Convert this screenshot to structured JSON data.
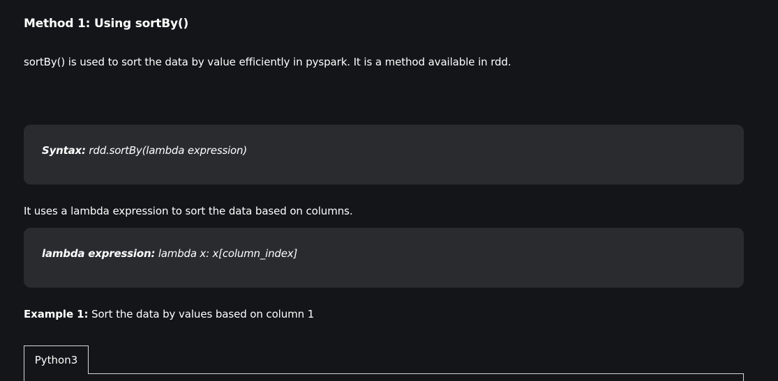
{
  "heading": "Method 1: Using sortBy()",
  "intro": "sortBy() is used to sort the data by value efficiently in pyspark. It is a method available in rdd.",
  "syntax": {
    "label": "Syntax:",
    "code": "rdd.sortBy(lambda expression)"
  },
  "uses_text": "It uses a lambda expression to sort the data based on columns.",
  "lambda": {
    "label": "lambda expression:",
    "code": "lambda x: x[column_index]"
  },
  "example": {
    "label": "Example 1:",
    "text": "Sort the data by values based on column 1"
  },
  "tabs": [
    {
      "label": "Python3",
      "active": true
    }
  ],
  "colors": {
    "background": "#141518",
    "code_box": "#2a2b2f",
    "text": "#ffffff",
    "tab_border": "#d8d8d8"
  }
}
